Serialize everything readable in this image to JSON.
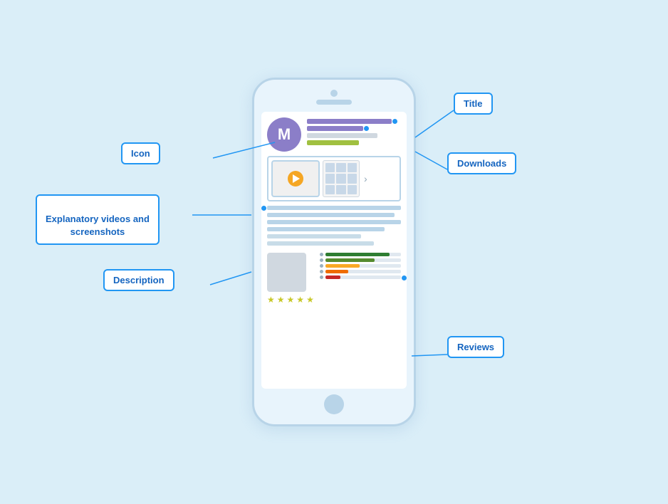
{
  "labels": {
    "title": "Title",
    "icon": "Icon",
    "downloads": "Downloads",
    "explanatory": "Explanatory videos and\nscreenshots",
    "description": "Description",
    "reviews": "Reviews"
  },
  "phone": {
    "app_icon_letter": "M",
    "chevron": "›"
  },
  "rating_bars": [
    {
      "color": "#2e7d32",
      "width": "85%"
    },
    {
      "color": "#558b2f",
      "width": "65%"
    },
    {
      "color": "#f9a825",
      "width": "45%"
    },
    {
      "color": "#ef6c00",
      "width": "30%"
    },
    {
      "color": "#c62828",
      "width": "20%"
    }
  ],
  "stars": [
    "★",
    "★",
    "★",
    "★",
    "★"
  ]
}
